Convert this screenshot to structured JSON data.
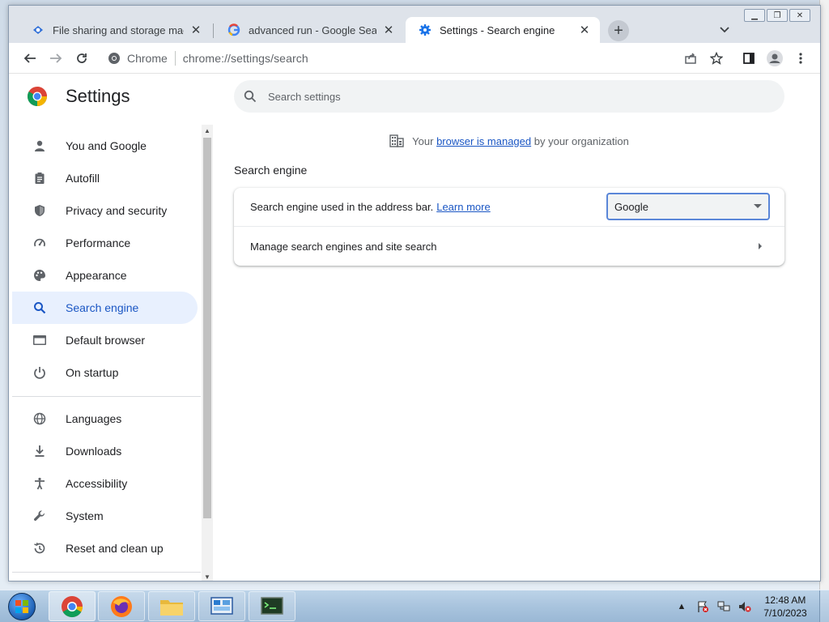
{
  "browser": {
    "tabs": [
      {
        "title": "File sharing and storage made si",
        "icon": "dropbox-like-icon",
        "active": false
      },
      {
        "title": "advanced run - Google Search",
        "icon": "google-g-icon",
        "active": false
      },
      {
        "title": "Settings - Search engine",
        "icon": "settings-gear-icon",
        "active": true
      }
    ],
    "new_tab_symbol": "+",
    "omnibox": {
      "chip_label": "Chrome",
      "url": "chrome://settings/search"
    }
  },
  "settings": {
    "title": "Settings",
    "search_placeholder": "Search settings",
    "nav": [
      {
        "label": "You and Google",
        "icon": "person-icon"
      },
      {
        "label": "Autofill",
        "icon": "clipboard-icon"
      },
      {
        "label": "Privacy and security",
        "icon": "shield-icon"
      },
      {
        "label": "Performance",
        "icon": "gauge-icon"
      },
      {
        "label": "Appearance",
        "icon": "palette-icon"
      },
      {
        "label": "Search engine",
        "icon": "search-icon",
        "selected": true
      },
      {
        "label": "Default browser",
        "icon": "browser-window-icon"
      },
      {
        "label": "On startup",
        "icon": "power-icon"
      },
      {
        "label": "Languages",
        "icon": "globe-icon"
      },
      {
        "label": "Downloads",
        "icon": "download-icon"
      },
      {
        "label": "Accessibility",
        "icon": "accessibility-icon"
      },
      {
        "label": "System",
        "icon": "wrench-icon"
      },
      {
        "label": "Reset and clean up",
        "icon": "history-icon"
      }
    ],
    "managed_notice": {
      "prefix": "Your",
      "link": "browser is managed",
      "suffix": "by your organization"
    },
    "section_title": "Search engine",
    "rows": {
      "engine_label": "Search engine used in the address bar.",
      "learn_more": "Learn more",
      "engine_value": "Google",
      "manage_label": "Manage search engines and site search"
    }
  },
  "taskbar": {
    "clock_time": "12:48 AM",
    "clock_date": "7/10/2023",
    "apps": [
      "chrome",
      "firefox",
      "file-explorer",
      "control-panel",
      "terminal"
    ]
  },
  "colors": {
    "accent": "#1a73e8",
    "selected_bg": "#e8f0fe",
    "link": "#1a56c4"
  }
}
